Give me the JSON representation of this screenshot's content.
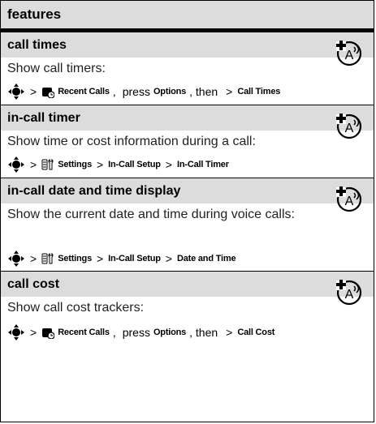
{
  "header": {
    "title": "features"
  },
  "sections": [
    {
      "title": "call times",
      "description": "Show call timers:",
      "path": {
        "app_label": "Recent Calls",
        "press": "press",
        "options": "Options",
        "then": ", then",
        "item": "Call Times"
      }
    },
    {
      "title": "in-call timer",
      "description": "Show time or cost information during a call:",
      "path": {
        "app_label": "Settings",
        "sub1": "In-Call Setup",
        "item": "In-Call Timer"
      }
    },
    {
      "title": "in-call date and time display",
      "description": "Show the current date and time during voice calls:",
      "path": {
        "app_label": "Settings",
        "sub1": "In-Call Setup",
        "item": "Date and Time"
      }
    },
    {
      "title": "call cost",
      "description": "Show call cost trackers:",
      "path": {
        "app_label": "Recent Calls",
        "press": "press",
        "options": "Options",
        "then": ", then",
        "item": "Call Cost"
      }
    }
  ],
  "symbols": {
    "gt": ">"
  },
  "icons": {
    "nav": "nav-key-icon",
    "recent_calls": "recent-calls-icon",
    "settings": "settings-icon",
    "network": "network-feature-icon"
  }
}
